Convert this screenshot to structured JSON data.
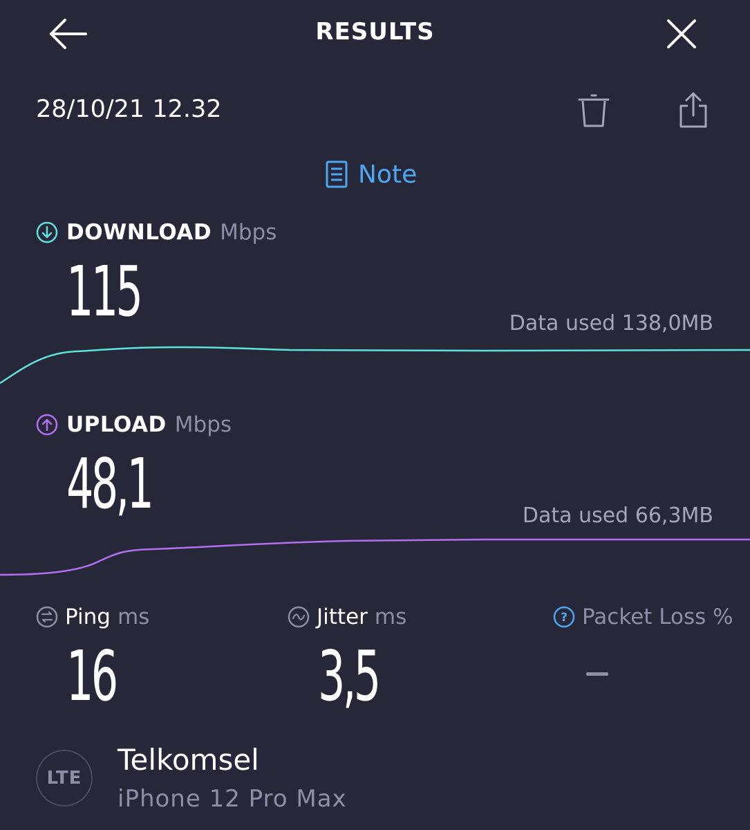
{
  "header": {
    "title": "RESULTS",
    "back_icon": "arrow-left-icon",
    "close_icon": "close-icon"
  },
  "result": {
    "timestamp": "28/10/21 12.32",
    "delete_icon": "trash-icon",
    "share_icon": "share-icon",
    "note_label": "Note",
    "note_icon": "note-icon"
  },
  "download": {
    "label": "DOWNLOAD",
    "unit": "Mbps",
    "value": "115",
    "data_used": "Data used 138,0MB",
    "color": "#5de4dc",
    "icon": "download-arrow-icon"
  },
  "upload": {
    "label": "UPLOAD",
    "unit": "Mbps",
    "value": "48,1",
    "data_used": "Data used 66,3MB",
    "color": "#b46ff0",
    "icon": "upload-arrow-icon"
  },
  "ping": {
    "label": "Ping",
    "unit": "ms",
    "value": "16",
    "icon": "ping-icon"
  },
  "jitter": {
    "label": "Jitter",
    "unit": "ms",
    "value": "3,5",
    "icon": "jitter-icon"
  },
  "packet_loss": {
    "label": "Packet Loss %",
    "value": "-",
    "icon": "help-icon",
    "color": "#4da8f4"
  },
  "connection": {
    "badge": "LTE",
    "carrier": "Telkomsel",
    "device": "iPhone 12 Pro Max"
  },
  "colors": {
    "background": "#262839",
    "accent": "#4da8f4",
    "muted_text": "#8d8fa6"
  }
}
